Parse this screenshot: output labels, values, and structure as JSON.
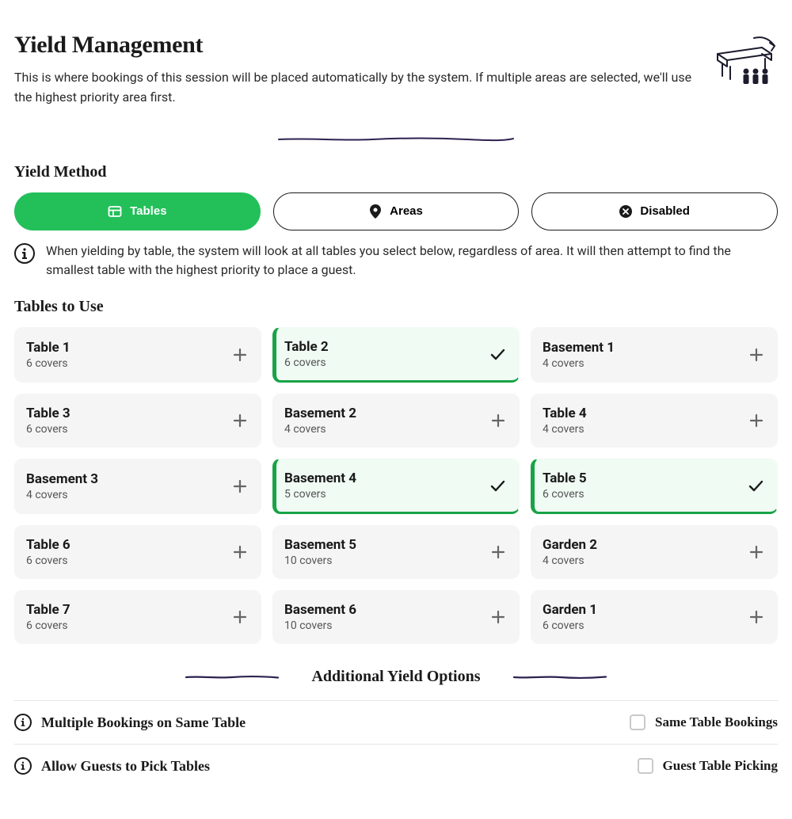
{
  "header": {
    "title": "Yield Management",
    "description": "This is where bookings of this session will be placed automatically by the system. If multiple areas are selected, we'll use the highest priority area first."
  },
  "yield_method": {
    "section_title": "Yield Method",
    "options": {
      "tables": "Tables",
      "areas": "Areas",
      "disabled": "Disabled"
    },
    "active": "tables",
    "info": "When yielding by table, the system will look at all tables you select below, regardless of area. It will then attempt to find the smallest table with the highest priority to place a guest."
  },
  "tables_section": {
    "title": "Tables to Use",
    "tables": [
      {
        "name": "Table 1",
        "covers": "6 covers",
        "selected": false
      },
      {
        "name": "Table 2",
        "covers": "6 covers",
        "selected": true
      },
      {
        "name": "Basement 1",
        "covers": "4 covers",
        "selected": false
      },
      {
        "name": "Table 3",
        "covers": "6 covers",
        "selected": false
      },
      {
        "name": "Basement 2",
        "covers": "4 covers",
        "selected": false
      },
      {
        "name": "Table 4",
        "covers": "4 covers",
        "selected": false
      },
      {
        "name": "Basement 3",
        "covers": "4 covers",
        "selected": false
      },
      {
        "name": "Basement 4",
        "covers": "5 covers",
        "selected": true
      },
      {
        "name": "Table 5",
        "covers": "6 covers",
        "selected": true
      },
      {
        "name": "Table 6",
        "covers": "6 covers",
        "selected": false
      },
      {
        "name": "Basement 5",
        "covers": "10 covers",
        "selected": false
      },
      {
        "name": "Garden 2",
        "covers": "4 covers",
        "selected": false
      },
      {
        "name": "Table 7",
        "covers": "6 covers",
        "selected": false
      },
      {
        "name": "Basement 6",
        "covers": "10 covers",
        "selected": false
      },
      {
        "name": "Garden 1",
        "covers": "6 covers",
        "selected": false
      }
    ]
  },
  "additional": {
    "title": "Additional Yield Options",
    "options": [
      {
        "left_label": "Multiple Bookings on Same Table",
        "right_label": "Same Table Bookings",
        "checked": false
      },
      {
        "left_label": "Allow Guests to Pick Tables",
        "right_label": "Guest Table Picking",
        "checked": false
      }
    ]
  },
  "colors": {
    "accent_green": "#23c05a",
    "accent_green_dark": "#17a346",
    "divider_purple": "#2e2250"
  }
}
